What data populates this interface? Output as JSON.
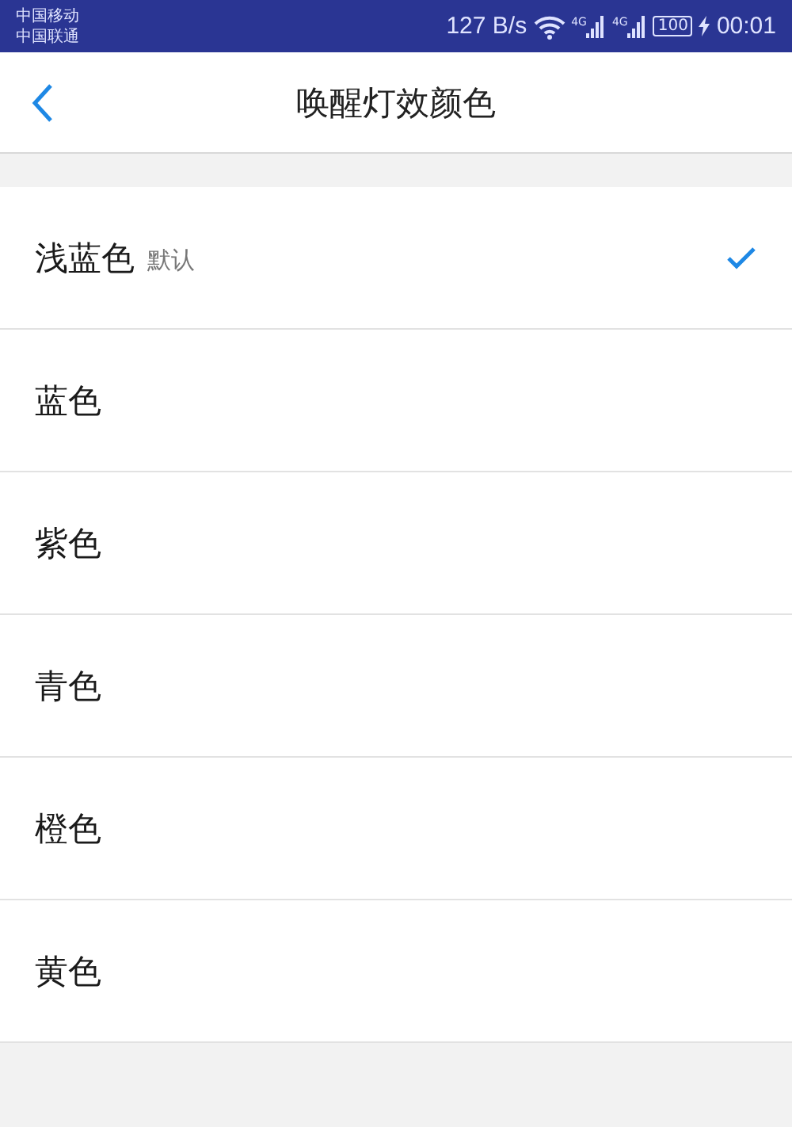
{
  "status_bar": {
    "carriers": [
      "中国移动",
      "中国联通"
    ],
    "speed": "127 B/s",
    "signals": [
      {
        "network": "4G"
      },
      {
        "network": "4G"
      }
    ],
    "battery": "100",
    "charging": true,
    "time": "00:01"
  },
  "header": {
    "title": "唤醒灯效颜色"
  },
  "options": [
    {
      "label": "浅蓝色",
      "note": "默认",
      "selected": true
    },
    {
      "label": "蓝色",
      "selected": false
    },
    {
      "label": "紫色",
      "selected": false
    },
    {
      "label": "青色",
      "selected": false
    },
    {
      "label": "橙色",
      "selected": false
    },
    {
      "label": "黄色",
      "selected": false
    }
  ]
}
